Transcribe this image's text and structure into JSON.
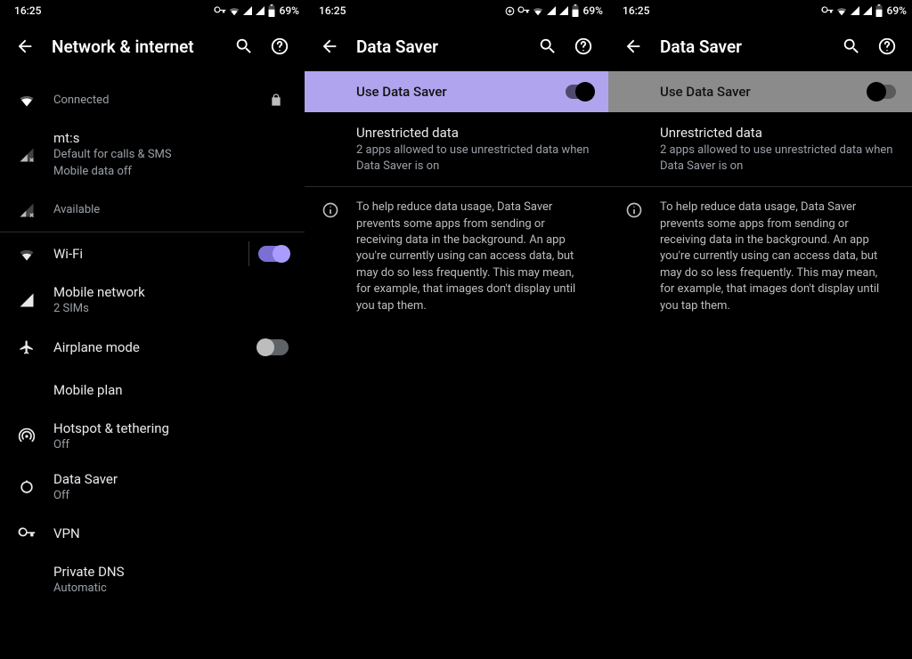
{
  "status": {
    "time": "16:25",
    "battery": "69%"
  },
  "pane1": {
    "title": "Network & internet",
    "wifi_summary": "Connected",
    "mts": {
      "title": "mt:s",
      "sub1": "Default for calls & SMS",
      "sub2": "Mobile data off"
    },
    "sim2_summary": "Available",
    "wifi": {
      "title": "Wi-Fi"
    },
    "mobile_network": {
      "title": "Mobile network",
      "sub": "2 SIMs"
    },
    "airplane": {
      "title": "Airplane mode"
    },
    "mobile_plan": {
      "title": "Mobile plan"
    },
    "hotspot": {
      "title": "Hotspot & tethering",
      "sub": "Off"
    },
    "data_saver": {
      "title": "Data Saver",
      "sub": "Off"
    },
    "vpn": {
      "title": "VPN"
    },
    "private_dns": {
      "title": "Private DNS",
      "sub": "Automatic"
    }
  },
  "pane2": {
    "title": "Data Saver",
    "switch_label": "Use Data Saver",
    "unrestricted": {
      "title": "Unrestricted data",
      "sub": "2 apps allowed to use unrestricted data when Data Saver is on"
    },
    "info": "To help reduce data usage, Data Saver prevents some apps from sending or receiving data in the background. An app you're currently using can access data, but may do so less frequently. This may mean, for example, that images don't display until you tap them."
  },
  "pane3": {
    "title": "Data Saver",
    "switch_label": "Use Data Saver",
    "unrestricted": {
      "title": "Unrestricted data",
      "sub": "2 apps allowed to use unrestricted data when Data Saver is on"
    },
    "info": "To help reduce data usage, Data Saver prevents some apps from sending or receiving data in the background. An app you're currently using can access data, but may do so less frequently. This may mean, for example, that images don't display until you tap them."
  }
}
